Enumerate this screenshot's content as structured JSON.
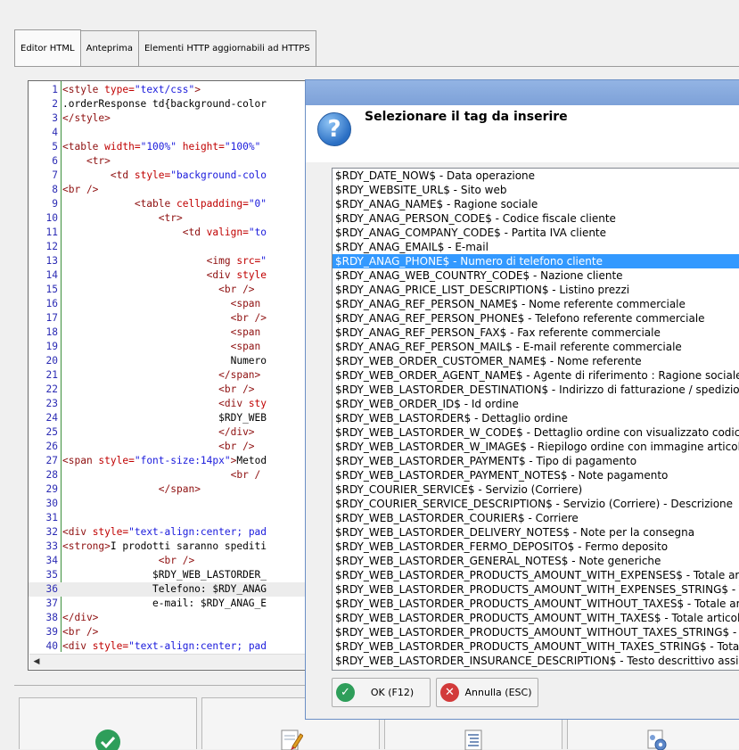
{
  "tabs": [
    "Editor HTML",
    "Anteprima",
    "Elementi HTTP aggiornabili ad HTTPS"
  ],
  "code_lines": [
    {
      "n": "1",
      "t": [
        [
          "tag",
          "<style "
        ],
        [
          "attr",
          "type="
        ],
        [
          "val",
          "\"text/css\""
        ],
        [
          "tag",
          ">"
        ]
      ]
    },
    {
      "n": "2",
      "t": [
        [
          "txt",
          ".orderResponse td{background-color"
        ]
      ]
    },
    {
      "n": "3",
      "t": [
        [
          "tag",
          "</style>"
        ]
      ]
    },
    {
      "n": "4",
      "t": []
    },
    {
      "n": "5",
      "t": [
        [
          "tag",
          "<table "
        ],
        [
          "attr",
          "width="
        ],
        [
          "val",
          "\"100%\""
        ],
        [
          "attr",
          " height="
        ],
        [
          "val",
          "\"100%\""
        ],
        [
          "txt",
          " "
        ]
      ]
    },
    {
      "n": "6",
      "t": [
        [
          "txt",
          "    "
        ],
        [
          "tag",
          "<tr>"
        ]
      ]
    },
    {
      "n": "7",
      "t": [
        [
          "txt",
          "        "
        ],
        [
          "tag",
          "<td "
        ],
        [
          "attr",
          "style="
        ],
        [
          "val",
          "\"background-colo"
        ]
      ]
    },
    {
      "n": "8",
      "t": [
        [
          "tag",
          "<br />"
        ]
      ]
    },
    {
      "n": "9",
      "t": [
        [
          "txt",
          "            "
        ],
        [
          "tag",
          "<table "
        ],
        [
          "attr",
          "cellpadding="
        ],
        [
          "val",
          "\"0\""
        ]
      ]
    },
    {
      "n": "10",
      "t": [
        [
          "txt",
          "                "
        ],
        [
          "tag",
          "<tr>"
        ]
      ]
    },
    {
      "n": "11",
      "t": [
        [
          "txt",
          "                    "
        ],
        [
          "tag",
          "<td "
        ],
        [
          "attr",
          "valign="
        ],
        [
          "val",
          "\"to"
        ]
      ]
    },
    {
      "n": "12",
      "t": []
    },
    {
      "n": "13",
      "t": [
        [
          "txt",
          "                        "
        ],
        [
          "tag",
          "<img "
        ],
        [
          "attr",
          "src="
        ],
        [
          "val",
          "\""
        ]
      ]
    },
    {
      "n": "14",
      "t": [
        [
          "txt",
          "                        "
        ],
        [
          "tag",
          "<div "
        ],
        [
          "attr",
          "style"
        ]
      ]
    },
    {
      "n": "15",
      "t": [
        [
          "txt",
          "                          "
        ],
        [
          "tag",
          "<br />"
        ]
      ]
    },
    {
      "n": "16",
      "t": [
        [
          "txt",
          "                            "
        ],
        [
          "tag",
          "<span"
        ]
      ]
    },
    {
      "n": "17",
      "t": [
        [
          "txt",
          "                            "
        ],
        [
          "tag",
          "<br />"
        ]
      ]
    },
    {
      "n": "18",
      "t": [
        [
          "txt",
          "                            "
        ],
        [
          "tag",
          "<span"
        ]
      ]
    },
    {
      "n": "19",
      "t": [
        [
          "txt",
          "                            "
        ],
        [
          "tag",
          "<span"
        ]
      ]
    },
    {
      "n": "20",
      "t": [
        [
          "txt",
          "                            Numero"
        ]
      ]
    },
    {
      "n": "21",
      "t": [
        [
          "txt",
          "                          "
        ],
        [
          "tag",
          "</span>"
        ]
      ]
    },
    {
      "n": "22",
      "t": [
        [
          "txt",
          "                          "
        ],
        [
          "tag",
          "<br />"
        ]
      ]
    },
    {
      "n": "23",
      "t": [
        [
          "txt",
          "                          "
        ],
        [
          "tag",
          "<div "
        ],
        [
          "attr",
          "sty"
        ]
      ]
    },
    {
      "n": "24",
      "t": [
        [
          "txt",
          "                          $RDY_WEB"
        ]
      ]
    },
    {
      "n": "25",
      "t": [
        [
          "txt",
          "                          "
        ],
        [
          "tag",
          "</div>"
        ]
      ]
    },
    {
      "n": "26",
      "t": [
        [
          "txt",
          "                          "
        ],
        [
          "tag",
          "<br />"
        ]
      ]
    },
    {
      "n": "27",
      "t": [
        [
          "tag",
          "<span "
        ],
        [
          "attr",
          "style="
        ],
        [
          "val",
          "\"font-size:14px\""
        ],
        [
          "tag",
          ">"
        ],
        [
          "txt",
          "Metod"
        ]
      ]
    },
    {
      "n": "28",
      "t": [
        [
          "txt",
          "                            "
        ],
        [
          "tag",
          "<br /"
        ]
      ]
    },
    {
      "n": "29",
      "t": [
        [
          "txt",
          "                "
        ],
        [
          "tag",
          "</span>"
        ]
      ]
    },
    {
      "n": "30",
      "t": []
    },
    {
      "n": "31",
      "t": []
    },
    {
      "n": "32",
      "t": [
        [
          "tag",
          "<div "
        ],
        [
          "attr",
          "style="
        ],
        [
          "val",
          "\"text-align:center; pad"
        ]
      ]
    },
    {
      "n": "33",
      "t": [
        [
          "tag",
          "<strong>"
        ],
        [
          "txt",
          "I prodotti saranno spediti"
        ]
      ]
    },
    {
      "n": "34",
      "t": [
        [
          "txt",
          "                "
        ],
        [
          "tag",
          "<br />"
        ]
      ]
    },
    {
      "n": "35",
      "t": [
        [
          "txt",
          "               $RDY_WEB_LASTORDER_"
        ]
      ]
    },
    {
      "n": "36",
      "t": [
        [
          "txt",
          "               Telefono: $RDY_ANAG"
        ]
      ]
    },
    {
      "n": "37",
      "t": [
        [
          "txt",
          "               e-mail: $RDY_ANAG_E"
        ]
      ]
    },
    {
      "n": "38",
      "t": [
        [
          "tag",
          "</div>"
        ]
      ]
    },
    {
      "n": "39",
      "t": [
        [
          "tag",
          "<br />"
        ]
      ]
    },
    {
      "n": "40",
      "t": [
        [
          "tag",
          "<div "
        ],
        [
          "attr",
          "style="
        ],
        [
          "val",
          "\"text-align:center; pad"
        ]
      ]
    }
  ],
  "highlight_line": 36,
  "dialog": {
    "prompt": "Selezionare il tag da inserire",
    "selected_index": 6,
    "items": [
      "$RDY_DATE_NOW$ - Data operazione",
      "$RDY_WEBSITE_URL$ - Sito web",
      "$RDY_ANAG_NAME$ - Ragione sociale",
      "$RDY_ANAG_PERSON_CODE$ - Codice fiscale cliente",
      "$RDY_ANAG_COMPANY_CODE$ - Partita IVA cliente",
      "$RDY_ANAG_EMAIL$ - E-mail",
      "$RDY_ANAG_PHONE$ - Numero di telefono cliente",
      "$RDY_ANAG_WEB_COUNTRY_CODE$ - Nazione cliente",
      "$RDY_ANAG_PRICE_LIST_DESCRIPTION$ - Listino prezzi",
      "$RDY_ANAG_REF_PERSON_NAME$ - Nome referente commerciale",
      "$RDY_ANAG_REF_PERSON_PHONE$ - Telefono referente commerciale",
      "$RDY_ANAG_REF_PERSON_FAX$ - Fax referente commerciale",
      "$RDY_ANAG_REF_PERSON_MAIL$ - E-mail referente commerciale",
      "$RDY_WEB_ORDER_CUSTOMER_NAME$ - Nome referente",
      "$RDY_WEB_ORDER_AGENT_NAME$ - Agente di riferimento : Ragione sociale",
      "$RDY_WEB_LASTORDER_DESTINATION$ - Indirizzo di fatturazione / spedizione",
      "$RDY_WEB_ORDER_ID$ - Id ordine",
      "$RDY_WEB_LASTORDER$ - Dettaglio ordine",
      "$RDY_WEB_LASTORDER_W_CODE$ - Dettaglio ordine con visualizzato codice ar",
      "$RDY_WEB_LASTORDER_W_IMAGE$ - Riepilogo ordine con immagine articolo v",
      "$RDY_WEB_LASTORDER_PAYMENT$ - Tipo di pagamento",
      "$RDY_WEB_LASTORDER_PAYMENT_NOTES$ - Note pagamento",
      "$RDY_COURIER_SERVICE$ - Servizio (Corriere)",
      "$RDY_COURIER_SERVICE_DESCRIPTION$ - Servizio (Corriere) - Descrizione",
      "$RDY_WEB_LASTORDER_COURIER$ - Corriere",
      "$RDY_WEB_LASTORDER_DELIVERY_NOTES$ - Note per la consegna",
      "$RDY_WEB_LASTORDER_FERMO_DEPOSITO$ - Fermo deposito",
      "$RDY_WEB_LASTORDER_GENERAL_NOTES$ - Note generiche",
      "$RDY_WEB_LASTORDER_PRODUCTS_AMOUNT_WITH_EXPENSES$ - Totale arti",
      "$RDY_WEB_LASTORDER_PRODUCTS_AMOUNT_WITH_EXPENSES_STRING$ - T",
      "$RDY_WEB_LASTORDER_PRODUCTS_AMOUNT_WITHOUT_TAXES$ - Totale art",
      "$RDY_WEB_LASTORDER_PRODUCTS_AMOUNT_WITH_TAXES$ - Totale articoli",
      "$RDY_WEB_LASTORDER_PRODUCTS_AMOUNT_WITHOUT_TAXES_STRING$ - T",
      "$RDY_WEB_LASTORDER_PRODUCTS_AMOUNT_WITH_TAXES_STRING$ - Total",
      "$RDY_WEB_LASTORDER_INSURANCE_DESCRIPTION$ - Testo descrittivo assicu"
    ],
    "ok_label": "OK (F12)",
    "cancel_label": "Annulla (ESC)"
  },
  "icons": {
    "dialog": "question-icon",
    "ok": "check-icon",
    "cancel": "cancel-x-icon",
    "bottom": [
      "check-circle-icon",
      "edit-document-icon",
      "list-document-icon",
      "settings-document-icon"
    ]
  }
}
